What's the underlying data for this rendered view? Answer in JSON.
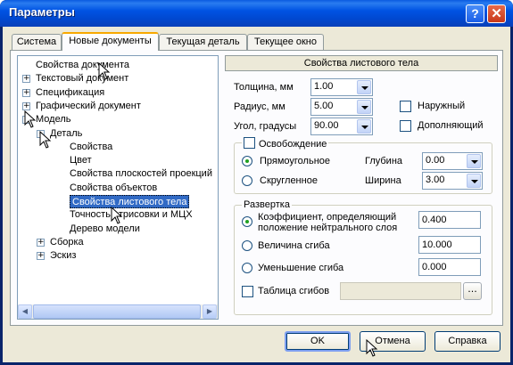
{
  "window": {
    "title": "Параметры",
    "help": "?",
    "close": "✕"
  },
  "tabs": [
    "Система",
    "Новые документы",
    "Текущая деталь",
    "Текущее окно"
  ],
  "tree": {
    "items": [
      {
        "label": "Свойства документа",
        "level": 0,
        "toggle": ""
      },
      {
        "label": "Текстовый документ",
        "level": 0,
        "toggle": "+"
      },
      {
        "label": "Спецификация",
        "level": 0,
        "toggle": "+"
      },
      {
        "label": "Графический документ",
        "level": 0,
        "toggle": "+"
      },
      {
        "label": "Модель",
        "level": 0,
        "toggle": "-"
      },
      {
        "label": "Деталь",
        "level": 1,
        "toggle": "-"
      },
      {
        "label": "Свойства",
        "level": 2,
        "toggle": ""
      },
      {
        "label": "Цвет",
        "level": 2,
        "toggle": ""
      },
      {
        "label": "Свойства плоскостей проекций",
        "level": 2,
        "toggle": ""
      },
      {
        "label": "Свойства объектов",
        "level": 2,
        "toggle": ""
      },
      {
        "label": "Свойства листового тела",
        "level": 2,
        "toggle": "",
        "selected": true
      },
      {
        "label": "Точность отрисовки и МЦХ",
        "level": 2,
        "toggle": ""
      },
      {
        "label": "Дерево модели",
        "level": 2,
        "toggle": ""
      },
      {
        "label": "Сборка",
        "level": 1,
        "toggle": "+"
      },
      {
        "label": "Эскиз",
        "level": 1,
        "toggle": "+"
      }
    ]
  },
  "panel": {
    "header": "Свойства листового тела",
    "thickness": {
      "label": "Толщина, мм",
      "value": "1.00"
    },
    "radius": {
      "label": "Радиус, мм",
      "value": "5.00"
    },
    "angle": {
      "label": "Угол, градусы",
      "value": "90.00"
    },
    "outer": {
      "label": "Наружный",
      "checked": false
    },
    "additional": {
      "label": "Дополняющий",
      "checked": false
    },
    "relief": {
      "title": "Освобождение",
      "checked": false,
      "rect": "Прямоугольное",
      "round": "Скругленное",
      "depth_label": "Глубина",
      "depth_value": "0.00",
      "width_label": "Ширина",
      "width_value": "3.00"
    },
    "unfold": {
      "title": "Развертка",
      "coef_label_1": "Коэффициент, определяющий",
      "coef_label_2": "положение нейтрального слоя",
      "coef_value": "0.400",
      "bend_label": "Величина сгиба",
      "bend_value": "10.000",
      "reduce_label": "Уменьшение сгиба",
      "reduce_value": "0.000",
      "table_label": "Таблица сгибов",
      "table_value": "",
      "browse": "..."
    }
  },
  "buttons": {
    "ok": "OK",
    "cancel": "Отмена",
    "help": "Справка"
  }
}
